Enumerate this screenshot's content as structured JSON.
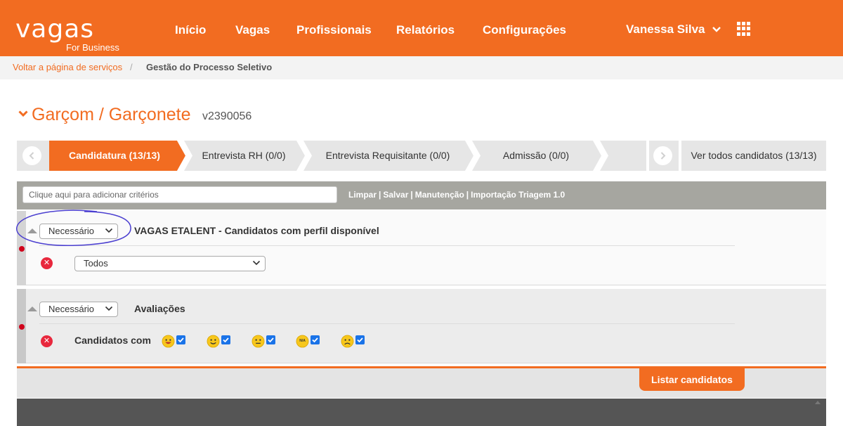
{
  "header": {
    "logo_word": "vagas",
    "logo_sub": "For Business",
    "nav": [
      "Início",
      "Vagas",
      "Profissionais",
      "Relatórios",
      "Configurações"
    ],
    "user_name": "Vanessa Silva",
    "apps_icon": "grid-icon"
  },
  "breadcrumb": {
    "back_link": "Voltar a página de serviços",
    "separator": "/",
    "current": "Gestão do Processo Seletivo"
  },
  "job": {
    "title": "Garçom / Garçonete",
    "code": "v2390056"
  },
  "pipeline": {
    "steps": [
      {
        "label": "Candidatura (13/13)",
        "active": true
      },
      {
        "label": "Entrevista RH (0/0)",
        "active": false
      },
      {
        "label": "Entrevista Requisitante (0/0)",
        "active": false
      },
      {
        "label": "Admissão (0/0)",
        "active": false
      },
      {
        "label": "",
        "active": false
      }
    ],
    "all_candidates": "Ver todos candidatos (13/13)"
  },
  "criteria": {
    "placeholder": "Clique aqui para adicionar critérios",
    "links": [
      "Limpar",
      "Salvar",
      "Manutenção",
      "Importação Triagem 1.0"
    ]
  },
  "filters": [
    {
      "requirement": "Necessário",
      "title": "VAGAS ETALENT - Candidatos com perfil disponível",
      "option": "Todos"
    },
    {
      "requirement": "Necessário",
      "title": "Avaliações",
      "label": "Candidatos com",
      "ratings": [
        {
          "icon": "very-happy-face-icon",
          "checked": true
        },
        {
          "icon": "happy-face-icon",
          "checked": true
        },
        {
          "icon": "neutral-face-icon",
          "checked": true
        },
        {
          "icon": "na-face-icon",
          "text": "N/A",
          "checked": true
        },
        {
          "icon": "sad-face-icon",
          "checked": true
        }
      ]
    }
  ],
  "actions": {
    "list_button": "Listar candidatos"
  },
  "colors": {
    "brand": "#f26c21",
    "danger": "#e8283d",
    "checkbox": "#1a73e8",
    "highlight": "#4b3fd0"
  }
}
